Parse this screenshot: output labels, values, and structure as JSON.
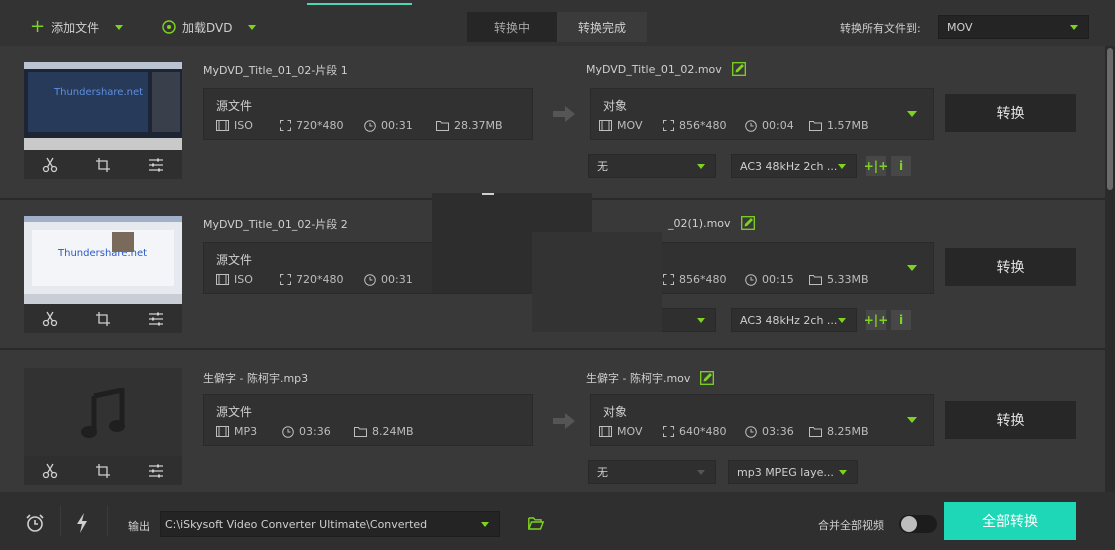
{
  "toolbar": {
    "add_file_label": "添加文件",
    "load_dvd_label": "加载DVD",
    "tabs": [
      {
        "label": "转换中",
        "active": true
      },
      {
        "label": "转换完成",
        "active": false
      }
    ],
    "convert_all_to_label": "转换所有文件到:",
    "output_format": "MOV"
  },
  "files": [
    {
      "source_name": "MyDVD_Title_01_02-片段 1",
      "source_box_title": "源文件",
      "source_format": "ISO",
      "source_resolution": "720*480",
      "source_duration": "00:31",
      "source_size": "28.37MB",
      "target_name": "MyDVD_Title_01_02.mov",
      "target_box_title": "对象",
      "target_format": "MOV",
      "target_resolution": "856*480",
      "target_duration": "00:04",
      "target_size": "1.57MB",
      "subtitle": "无",
      "audio": "AC3 48kHz 2ch ...",
      "convert_label": "转换",
      "thumb_text": "Thundershare.net"
    },
    {
      "source_name": "MyDVD_Title_01_02-片段 2",
      "source_box_title": "源文件",
      "source_format": "ISO",
      "source_resolution": "720*480",
      "source_duration": "00:31",
      "target_name": "_02(1).mov",
      "target_resolution": "856*480",
      "target_duration": "00:15",
      "target_size": "5.33MB",
      "audio": "AC3 48kHz 2ch ...",
      "convert_label": "转换",
      "thumb_text": "Thundershare.net"
    },
    {
      "source_name": "生僻字 - 陈柯宇.mp3",
      "source_box_title": "源文件",
      "source_format": "MP3",
      "source_duration": "03:36",
      "source_size": "8.24MB",
      "target_name": "生僻字 - 陈柯宇.mov",
      "target_box_title": "对象",
      "target_format": "MOV",
      "target_resolution": "640*480",
      "target_duration": "03:36",
      "target_size": "8.25MB",
      "subtitle": "无",
      "audio": "mp3 MPEG laye...",
      "convert_label": "转换"
    }
  ],
  "bottom": {
    "output_label": "输出",
    "output_path": "C:\\iSkysoft Video Converter Ultimate\\Converted",
    "merge_label": "合并全部视频",
    "merge_enabled": false,
    "convert_all_label": "全部转换"
  },
  "colors": {
    "accent_green": "#7ed321",
    "accent_teal": "#1ed7b6",
    "background": "#2b2b2b"
  }
}
